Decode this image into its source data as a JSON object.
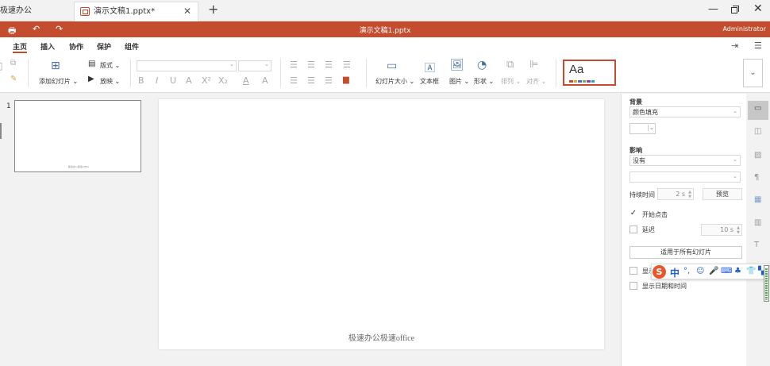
{
  "tabs": {
    "app": "极速办公",
    "doc": "演示文稿1.pptx*"
  },
  "titlebar": {
    "title": "演示文稿1.pptx",
    "user": "Administrator"
  },
  "menu": [
    "主页",
    "插入",
    "协作",
    "保护",
    "组件"
  ],
  "ribbon": {
    "add_slide": "添加幻灯片",
    "layout": "版式",
    "play": "放映",
    "slide_size": "幻灯片大小",
    "textbox": "文本框",
    "picture": "图片",
    "shape": "形状",
    "arrange": "排列",
    "align": "对齐",
    "theme_sample": "Aa",
    "theme_colors": [
      "#c34d2e",
      "#e3a52f",
      "#4472c4",
      "#7fb241",
      "#8e44ad",
      "#2aa3c4"
    ]
  },
  "slides": [
    {
      "number": "1",
      "text": "极速办公极速office"
    }
  ],
  "canvas": {
    "footer": "极速办公极速office"
  },
  "side": {
    "background_label": "背景",
    "fill_value": "颜色填充",
    "effect_label": "影响",
    "effect_value": "没有",
    "duration_label": "持续时间",
    "duration_value": "2 s",
    "preview": "预览",
    "on_click": "开始点击",
    "delay": "延迟",
    "delay_value": "10 s",
    "apply_all": "适用于所有幻灯片",
    "show_num": "显示",
    "show_date": "显示日期和时间"
  },
  "ime": {
    "label": "中"
  }
}
